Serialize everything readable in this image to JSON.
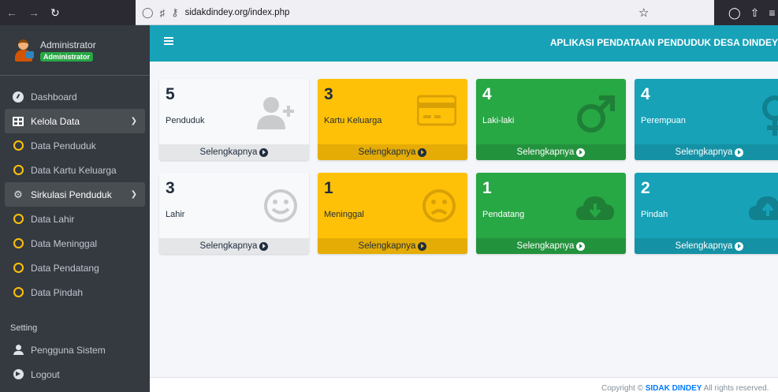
{
  "browser": {
    "url": "sidakdindey.org/index.php"
  },
  "sidebar": {
    "user_name": "Administrator",
    "user_role": "Administrator",
    "items": [
      {
        "label": "Dashboard"
      },
      {
        "label": "Kelola Data"
      },
      {
        "label": "Data Penduduk"
      },
      {
        "label": "Data Kartu Keluarga"
      },
      {
        "label": "Sirkulasi Penduduk"
      },
      {
        "label": "Data Lahir"
      },
      {
        "label": "Data Meninggal"
      },
      {
        "label": "Data Pendatang"
      },
      {
        "label": "Data Pindah"
      }
    ],
    "setting_header": "Setting",
    "pengguna_label": "Pengguna Sistem",
    "logout_label": "Logout"
  },
  "header": {
    "title": "APLIKASI PENDATAAN PENDUDUK DESA DINDEY"
  },
  "cards": [
    {
      "value": "5",
      "label": "Penduduk",
      "link": "Selengkapnya",
      "color": "#f8f9fa",
      "icon": "user-plus-icon"
    },
    {
      "value": "3",
      "label": "Kartu Keluarga",
      "link": "Selengkapnya",
      "color": "#ffc107",
      "icon": "credit-card-icon"
    },
    {
      "value": "4",
      "label": "Laki-laki",
      "link": "Selengkapnya",
      "color": "#28a745",
      "icon": "male-icon"
    },
    {
      "value": "4",
      "label": "Perempuan",
      "link": "Selengkapnya",
      "color": "#17a2b8",
      "icon": "female-icon"
    },
    {
      "value": "3",
      "label": "Lahir",
      "link": "Selengkapnya",
      "color": "#f8f9fa",
      "icon": "smile-icon"
    },
    {
      "value": "1",
      "label": "Meninggal",
      "link": "Selengkapnya",
      "color": "#ffc107",
      "icon": "frown-icon"
    },
    {
      "value": "1",
      "label": "Pendatang",
      "link": "Selengkapnya",
      "color": "#28a745",
      "icon": "cloud-download-icon"
    },
    {
      "value": "2",
      "label": "Pindah",
      "link": "Selengkapnya",
      "color": "#17a2b8",
      "icon": "cloud-upload-icon"
    }
  ],
  "footer": {
    "prefix": "Copyright ©",
    "brand": "SIDAK DINDEY",
    "suffix": "All rights reserved."
  }
}
